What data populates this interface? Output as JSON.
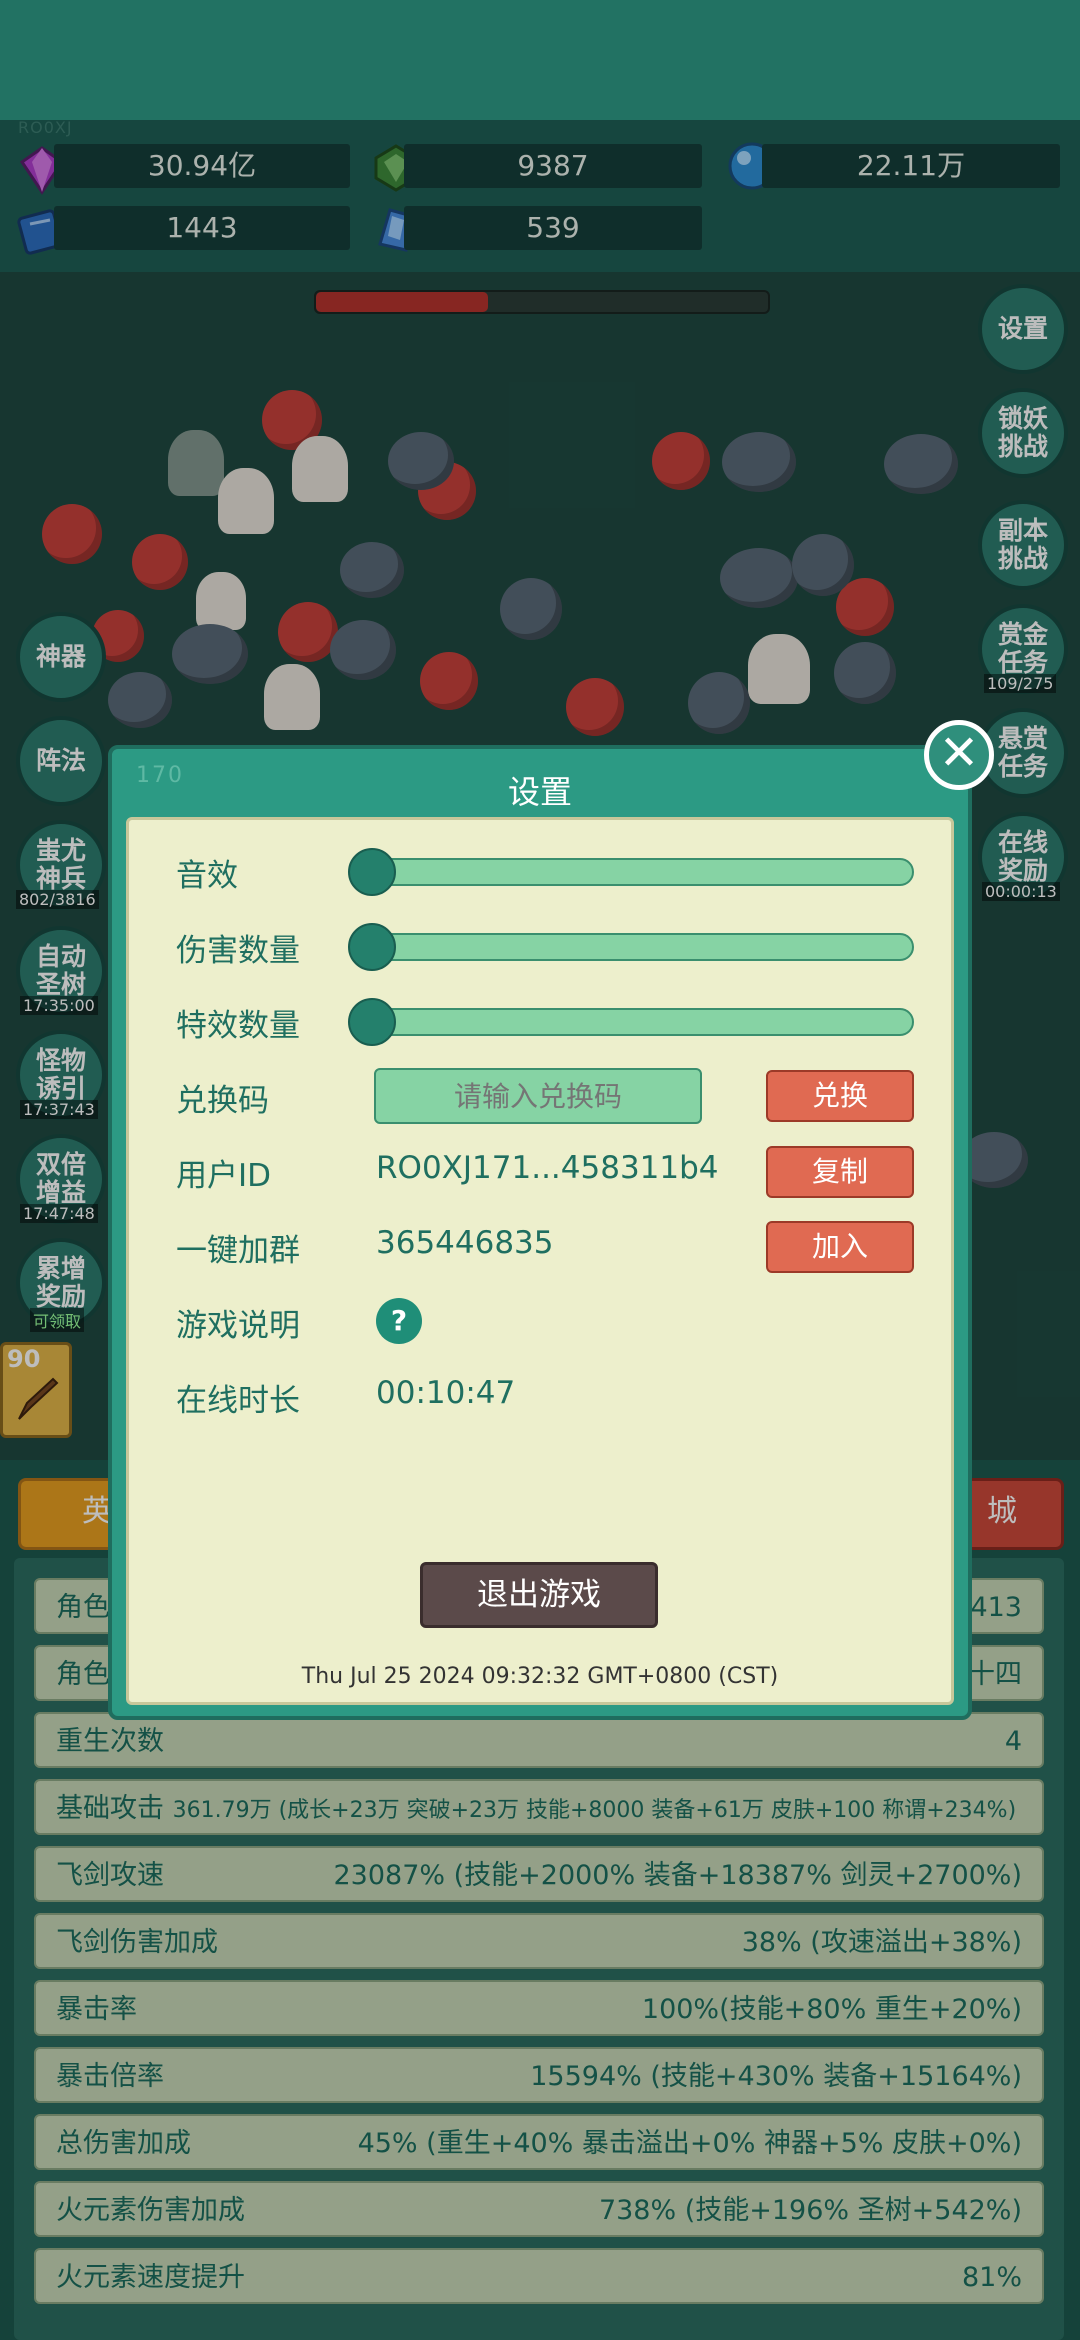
{
  "player_code": "RO0XJ",
  "resources": [
    {
      "icon": "purple-gem-icon",
      "value": "30.94亿"
    },
    {
      "icon": "green-gem-icon",
      "value": "9387"
    },
    {
      "icon": "blue-orb-icon",
      "value": "22.11万"
    },
    {
      "icon": "blue-book-icon",
      "value": "1443"
    },
    {
      "icon": "blue-crystal-icon",
      "value": "539"
    }
  ],
  "boss_hp_fraction": 0.38,
  "right_buttons": [
    {
      "label": "设置",
      "sub": ""
    },
    {
      "label": "锁妖挑战",
      "sub": ""
    },
    {
      "label": "副本挑战",
      "sub": ""
    },
    {
      "label": "赏金任务",
      "sub": "109/275"
    },
    {
      "label": "悬赏任务",
      "sub": ""
    },
    {
      "label": "在线奖励",
      "sub": "00:00:13"
    }
  ],
  "left_buttons": [
    {
      "label": "神器",
      "sub": ""
    },
    {
      "label": "阵法",
      "sub": ""
    },
    {
      "label": "蚩尤神兵",
      "sub": "802/3816"
    },
    {
      "label": "自动圣树",
      "sub": "17:35:00"
    },
    {
      "label": "怪物诱引",
      "sub": "17:37:43"
    },
    {
      "label": "双倍增益",
      "sub": "17:47:48"
    },
    {
      "label": "累增奖励",
      "sub": "可领取"
    }
  ],
  "skill_slot_level": "90",
  "tabs": {
    "left": "英",
    "right": "城"
  },
  "stats": [
    {
      "k": "角色",
      "v": "413"
    },
    {
      "k": "角色",
      "v": "十四"
    },
    {
      "k": "重生次数",
      "v": "4"
    },
    {
      "k": "基础攻击",
      "k_detail": "361.79万 (成长+23万 突破+23万 技能+8000 装备+61万 皮肤+100 称谓+234%)",
      "v": ""
    },
    {
      "k": "飞剑攻速",
      "v": "23087% (技能+2000% 装备+18387% 剑灵+2700%)"
    },
    {
      "k": "飞剑伤害加成",
      "v": "38% (攻速溢出+38%)"
    },
    {
      "k": "暴击率",
      "v": "100%(技能+80% 重生+20%)"
    },
    {
      "k": "暴击倍率",
      "v": "15594% (技能+430% 装备+15164%)"
    },
    {
      "k": "总伤害加成",
      "v": "45% (重生+40% 暴击溢出+0% 神器+5% 皮肤+0%)"
    },
    {
      "k": "火元素伤害加成",
      "v": "738% (技能+196% 圣树+542%)"
    },
    {
      "k": "火元素速度提升",
      "v": "81%"
    }
  ],
  "dialog": {
    "level": "170",
    "title": "设置",
    "sound_label": "音效",
    "damage_count_label": "伤害数量",
    "effect_count_label": "特效数量",
    "sound_level": 0,
    "damage_count_level": 0,
    "effect_count_level": 0,
    "redeem_label": "兑换码",
    "redeem_placeholder": "请输入兑换码",
    "redeem_button": "兑换",
    "user_id_label": "用户ID",
    "user_id_value": "RO0XJ171...458311b4",
    "copy_button": "复制",
    "group_label": "一键加群",
    "group_value": "365446835",
    "join_button": "加入",
    "guide_label": "游戏说明",
    "help_glyph": "?",
    "online_label": "在线时长",
    "online_value": "00:10:47",
    "exit_button": "退出游戏",
    "datetime": "Thu Jul 25 2024 09:32:32 GMT+0800 (CST)",
    "close_glyph": "✕"
  }
}
